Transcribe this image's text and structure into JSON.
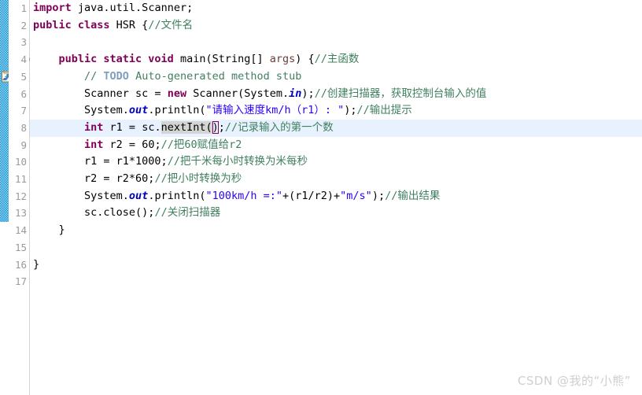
{
  "editor": {
    "language": "java",
    "current_line": 8,
    "colors": {
      "keyword": "#7f0055",
      "string": "#2a00ff",
      "comment": "#3f7f5f",
      "todo": "#7f9fbf",
      "field": "#0000c0",
      "parameter": "#6a3e3e",
      "current_line_bg": "#e8f2fe",
      "change_bar": "#1a9ad6",
      "gutter_text": "#9a9a9a",
      "occurrence_bg": "#d4d4d4"
    },
    "gutter": {
      "line_numbers": [
        "1",
        "2",
        "3",
        "4",
        "5",
        "6",
        "7",
        "8",
        "9",
        "10",
        "11",
        "12",
        "13",
        "14",
        "15",
        "16",
        "17"
      ],
      "fold_marker_line": "4",
      "task_marker_line": "5",
      "task_marker_icon": "todo-task-icon"
    },
    "lines": [
      {
        "number": "1",
        "tokens": [
          {
            "t": "import",
            "c": "kw"
          },
          {
            "t": " java.util.Scanner;",
            "c": "plain"
          }
        ]
      },
      {
        "number": "2",
        "tokens": [
          {
            "t": "public class",
            "c": "kw"
          },
          {
            "t": " HSR {",
            "c": "plain"
          },
          {
            "t": "//文件名",
            "c": "cmt"
          }
        ]
      },
      {
        "number": "3",
        "tokens": []
      },
      {
        "number": "4",
        "tokens": [
          {
            "t": "    ",
            "c": "plain"
          },
          {
            "t": "public static void",
            "c": "kw"
          },
          {
            "t": " main(String[] ",
            "c": "plain"
          },
          {
            "t": "args",
            "c": "param"
          },
          {
            "t": ") {",
            "c": "plain"
          },
          {
            "t": "//主函数",
            "c": "cmt"
          }
        ]
      },
      {
        "number": "5",
        "tokens": [
          {
            "t": "        ",
            "c": "plain"
          },
          {
            "t": "// ",
            "c": "cmt"
          },
          {
            "t": "TODO",
            "c": "todo"
          },
          {
            "t": " Auto-generated method stub",
            "c": "cmt"
          }
        ]
      },
      {
        "number": "6",
        "tokens": [
          {
            "t": "        Scanner sc = ",
            "c": "plain"
          },
          {
            "t": "new",
            "c": "kw"
          },
          {
            "t": " Scanner(System.",
            "c": "plain"
          },
          {
            "t": "in",
            "c": "fieldkw"
          },
          {
            "t": ");",
            "c": "plain"
          },
          {
            "t": "//创建扫描器，获取控制台输入的值",
            "c": "cmt"
          }
        ]
      },
      {
        "number": "7",
        "tokens": [
          {
            "t": "        System.",
            "c": "plain"
          },
          {
            "t": "out",
            "c": "fieldkw"
          },
          {
            "t": ".println(",
            "c": "plain"
          },
          {
            "t": "\"请输入速度km/h（r1）: \"",
            "c": "str"
          },
          {
            "t": ");",
            "c": "plain"
          },
          {
            "t": "//输出提示",
            "c": "cmt"
          }
        ]
      },
      {
        "number": "8",
        "tokens": [
          {
            "t": "        ",
            "c": "plain"
          },
          {
            "t": "int",
            "c": "kw"
          },
          {
            "t": " r1 = sc.",
            "c": "plain"
          },
          {
            "t": "nextInt",
            "c": "plain occ"
          },
          {
            "t": "(",
            "c": "plain occ"
          },
          {
            "t": ")",
            "c": "plain brmatch"
          },
          {
            "t": ";",
            "c": "plain"
          },
          {
            "t": "//记录输入的第一个数",
            "c": "cmt"
          }
        ]
      },
      {
        "number": "9",
        "tokens": [
          {
            "t": "        ",
            "c": "plain"
          },
          {
            "t": "int",
            "c": "kw"
          },
          {
            "t": " r2 = 60;",
            "c": "plain"
          },
          {
            "t": "//把60赋值给r2",
            "c": "cmt"
          }
        ]
      },
      {
        "number": "10",
        "tokens": [
          {
            "t": "        r1 = r1*1000;",
            "c": "plain"
          },
          {
            "t": "//把千米每小时转换为米每秒",
            "c": "cmt"
          }
        ]
      },
      {
        "number": "11",
        "tokens": [
          {
            "t": "        r2 = r2*60;",
            "c": "plain"
          },
          {
            "t": "//把小时转换为秒",
            "c": "cmt"
          }
        ]
      },
      {
        "number": "12",
        "tokens": [
          {
            "t": "        System.",
            "c": "plain"
          },
          {
            "t": "out",
            "c": "fieldkw"
          },
          {
            "t": ".println(",
            "c": "plain"
          },
          {
            "t": "\"100km/h =:\"",
            "c": "str"
          },
          {
            "t": "+(r1/r2)+",
            "c": "plain"
          },
          {
            "t": "\"m/s\"",
            "c": "str"
          },
          {
            "t": ");",
            "c": "plain"
          },
          {
            "t": "//输出结果",
            "c": "cmt"
          }
        ]
      },
      {
        "number": "13",
        "tokens": [
          {
            "t": "        sc.close();",
            "c": "plain"
          },
          {
            "t": "//关闭扫描器",
            "c": "cmt"
          }
        ]
      },
      {
        "number": "14",
        "tokens": [
          {
            "t": "    }",
            "c": "plain"
          }
        ]
      },
      {
        "number": "15",
        "tokens": []
      },
      {
        "number": "16",
        "tokens": [
          {
            "t": "}",
            "c": "plain"
          }
        ]
      },
      {
        "number": "17",
        "tokens": []
      }
    ]
  },
  "watermark": {
    "text": "CSDN @我的“小熊”"
  }
}
